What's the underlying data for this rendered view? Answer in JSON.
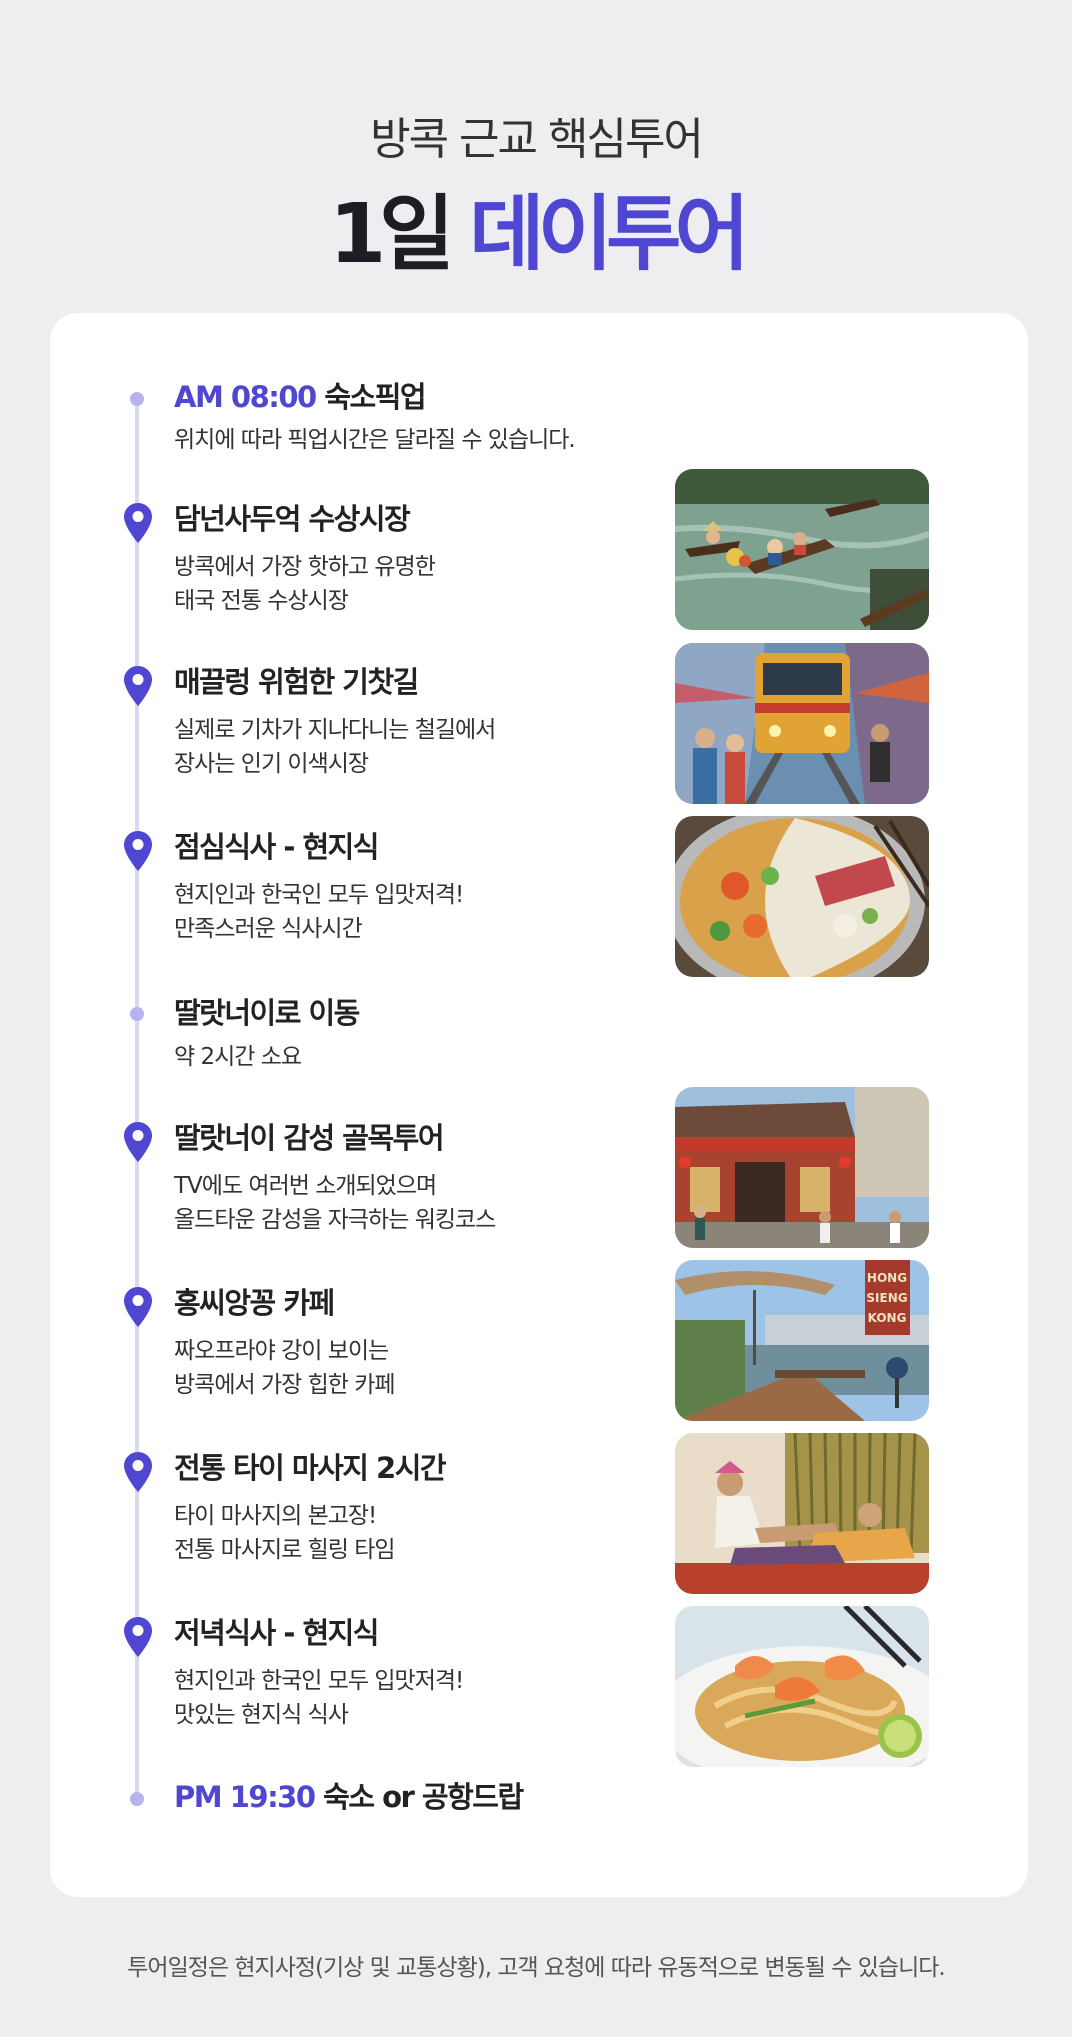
{
  "header": {
    "subtitle": "방콕 근교 핵심투어",
    "title_dark": "1일",
    "title_accent": "데이투어"
  },
  "colors": {
    "accent": "#4f47d1",
    "timeline": "#d8d8ee",
    "dot": "#b6b3ee"
  },
  "itinerary": [
    {
      "marker": "dot",
      "time": "AM 08:00",
      "title": "숙소픽업",
      "desc": [
        "위치에 따라 픽업시간은 달라질 수 있습니다."
      ]
    },
    {
      "marker": "location-pin-icon",
      "title": "담넌사두억 수상시장",
      "desc": [
        "방콕에서 가장 핫하고 유명한",
        "태국 전통 수상시장"
      ],
      "photo": "floating-market-photo"
    },
    {
      "marker": "location-pin-icon",
      "title": "매끌렁 위험한 기찻길",
      "desc": [
        "실제로 기차가 지나다니는 철길에서",
        "장사는 인기 이색시장"
      ],
      "photo": "railway-market-photo"
    },
    {
      "marker": "location-pin-icon",
      "title": "점심식사 - 현지식",
      "desc": [
        "현지인과 한국인 모두 입맛저격!",
        "만족스러운 식사시간"
      ],
      "photo": "hotpot-lunch-photo"
    },
    {
      "marker": "dot",
      "title": "딸랏너이로 이동",
      "desc": [
        "약 2시간 소요"
      ]
    },
    {
      "marker": "location-pin-icon",
      "title": "딸랏너이 감성 골목투어",
      "desc": [
        "TV에도 여러번 소개되었으며",
        "올드타운 감성을 자극하는 워킹코스"
      ],
      "photo": "old-town-alley-photo"
    },
    {
      "marker": "location-pin-icon",
      "title": "홍씨앙꽁 카페",
      "desc": [
        "짜오프라야 강이 보이는",
        "방콕에서 가장 힙한 카페"
      ],
      "photo": "riverside-cafe-photo"
    },
    {
      "marker": "location-pin-icon",
      "title": "전통 타이 마사지 2시간",
      "desc": [
        "타이 마사지의 본고장!",
        "전통 마사지로 힐링 타임"
      ],
      "photo": "thai-massage-photo"
    },
    {
      "marker": "location-pin-icon",
      "title": "저녁식사 - 현지식",
      "desc": [
        "현지인과 한국인 모두 입맛저격!",
        "맛있는 현지식 식사"
      ],
      "photo": "pad-thai-dinner-photo"
    },
    {
      "marker": "dot",
      "time": "PM 19:30",
      "title": "숙소 or 공항드랍"
    }
  ],
  "cafe_sign": [
    "HONG",
    "SIENG",
    "KONG"
  ],
  "footnote": "투어일정은 현지사정(기상 및 교통상황), 고객 요청에 따라 유동적으로 변동될 수 있습니다."
}
